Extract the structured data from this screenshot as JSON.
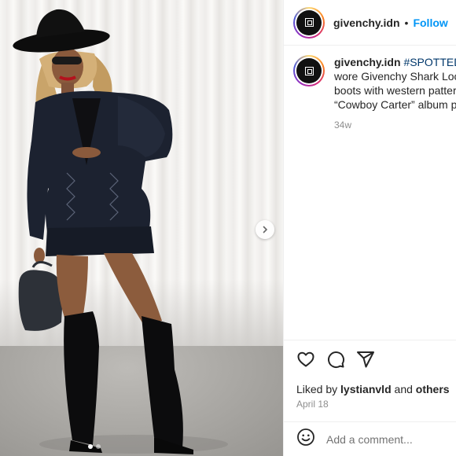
{
  "post": {
    "username": "givenchy.idn",
    "separator": "•",
    "follow_label": "Follow"
  },
  "caption": {
    "username": "givenchy.idn",
    "hashtag": "#SPOTTED @",
    "line2": "wore Givenchy Shark Lock",
    "line3": "boots with western patter",
    "line4": "“Cowboy Carter” album p",
    "age": "34w"
  },
  "actions": {
    "like_icon": "heart-icon",
    "comment_icon": "comment-icon",
    "share_icon": "share-icon"
  },
  "likes": {
    "prefix": "Liked by",
    "user": "lystianvld",
    "middle": "and",
    "others": "others"
  },
  "date": "April 18",
  "comment": {
    "placeholder": "Add a comment...",
    "emoji_icon": "emoji-icon"
  },
  "carousel": {
    "next_icon": "chevron-right-icon",
    "dot_count": 2,
    "active_dot": 1
  },
  "colors": {
    "follow": "#0095f6",
    "hashtag": "#00376b",
    "muted": "#8e8e8e"
  }
}
